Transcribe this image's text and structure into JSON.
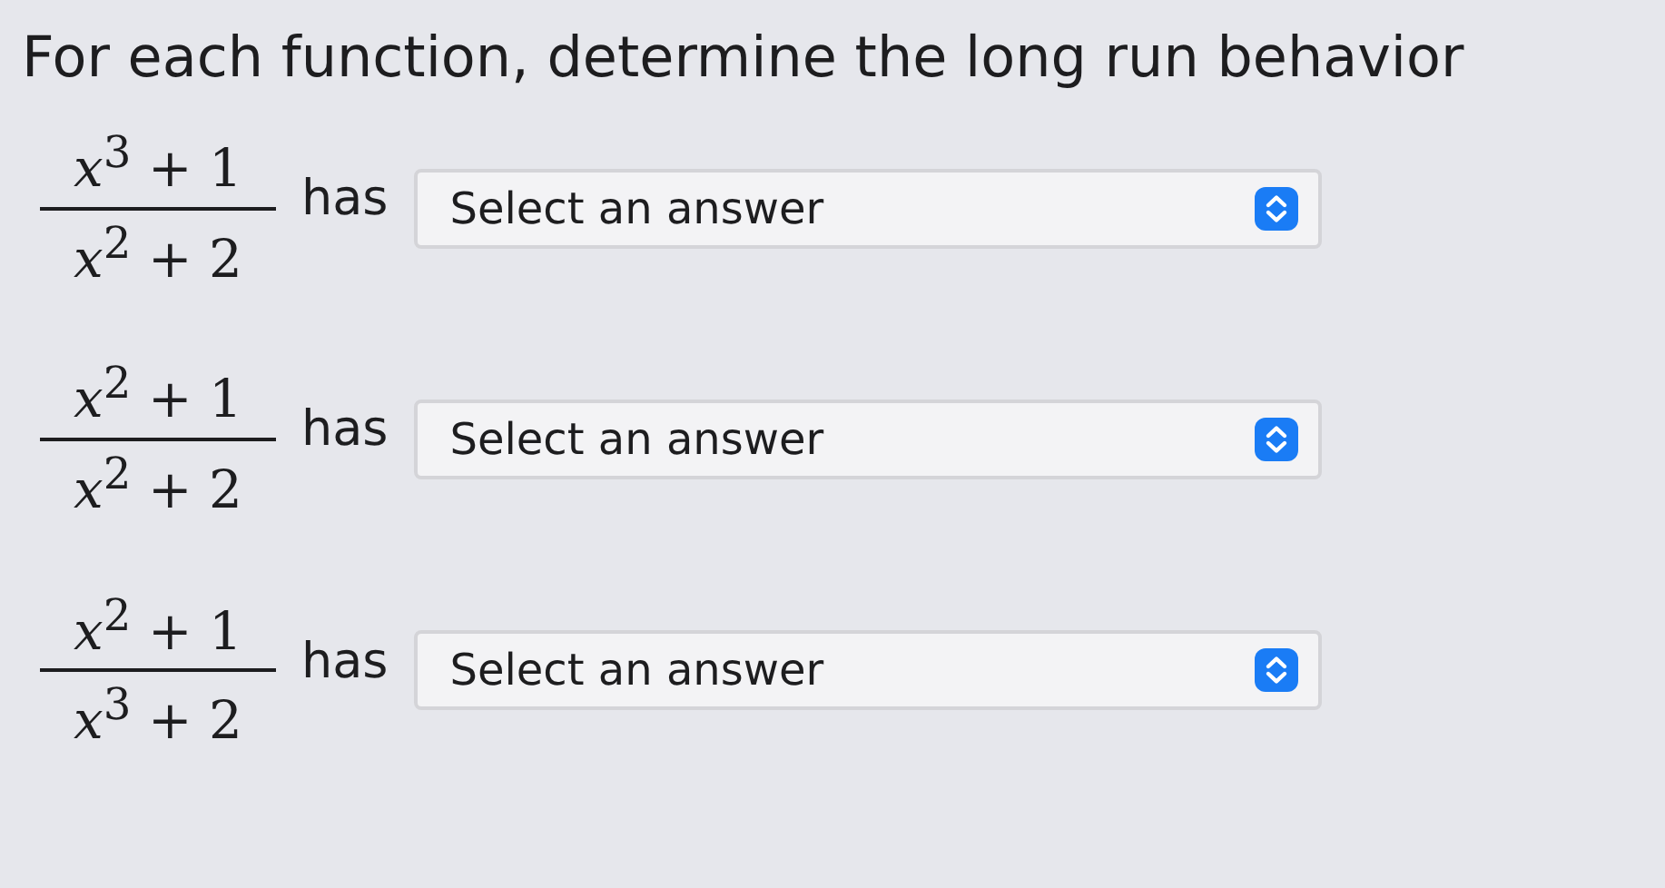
{
  "title": "For each function, determine the long run behavior",
  "rows": [
    {
      "numerator": "*x*$^{3}$ + 1",
      "denominator": "*x*$^{2}$ + 2",
      "connector": "has",
      "select": {
        "placeholder": "Select an answer"
      }
    },
    {
      "numerator": "*x*$^{2}$ + 1",
      "denominator": "*x*$^{2}$ + 2",
      "connector": "has",
      "select": {
        "placeholder": "Select an answer"
      }
    },
    {
      "numerator": "*x*$^{2}$ + 1",
      "denominator": "*x*$^{3}$ + 2",
      "connector": "has",
      "select": {
        "placeholder": "Select an answer"
      }
    }
  ]
}
